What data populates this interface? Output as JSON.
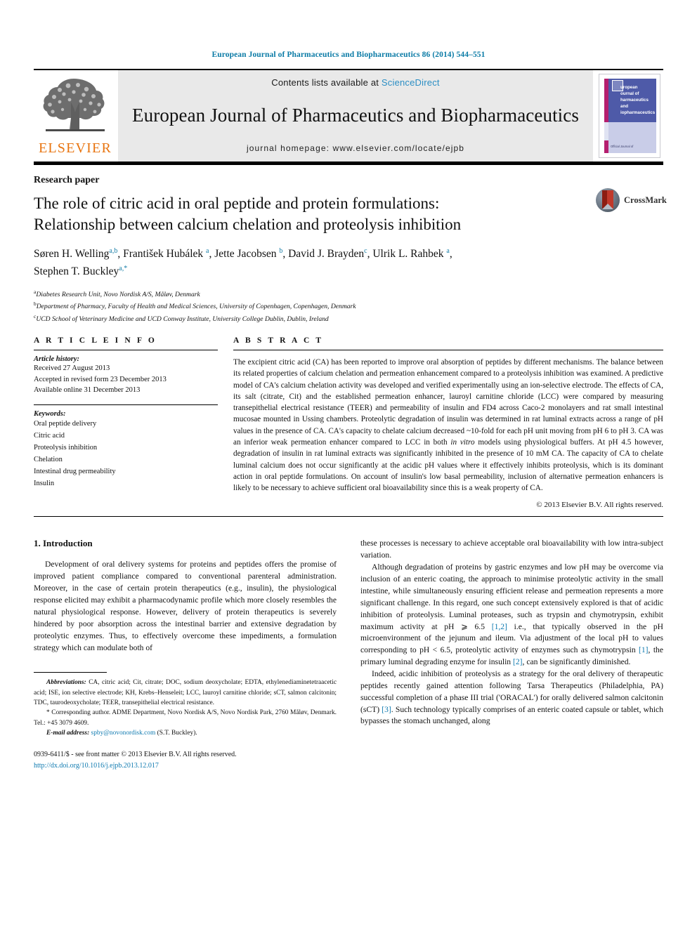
{
  "running_head": "European Journal of Pharmaceutics and Biopharmaceutics 86 (2014) 544–551",
  "masthead": {
    "publisher_name": "ELSEVIER",
    "contents_prefix": "Contents lists available at ",
    "sciencedirect": "ScienceDirect",
    "journal_name": "European Journal of Pharmaceutics and Biopharmaceutics",
    "homepage": "journal homepage: www.elsevier.com/locate/ejpb",
    "cover_title_line1": "uropean",
    "cover_title_line2": "ournal of",
    "cover_title_line3": "harmaceutics and",
    "cover_title_line4": "iopharmaceutics",
    "cover_footer": "Official Journal of"
  },
  "article": {
    "type": "Research paper",
    "title_line1": "The role of citric acid in oral peptide and protein formulations:",
    "title_line2": "Relationship between calcium chelation and proteolysis inhibition",
    "crossmark_label": "CrossMark",
    "authors_line1_parts": [
      {
        "name": "Søren H. Welling",
        "sup": "a,b"
      },
      {
        "name": "František Hubálek",
        "sup": "a"
      },
      {
        "name": "Jette Jacobsen",
        "sup": "b"
      },
      {
        "name": "David J. Brayden",
        "sup": "c"
      },
      {
        "name": "Ulrik L. Rahbek",
        "sup": "a"
      }
    ],
    "authors_line2": [
      {
        "name": "Stephen T. Buckley",
        "sup": "a,*"
      }
    ],
    "affiliations": [
      {
        "marker": "a",
        "text": "Diabetes Research Unit, Novo Nordisk A/S, Måløv, Denmark"
      },
      {
        "marker": "b",
        "text": "Department of Pharmacy, Faculty of Health and Medical Sciences, University of Copenhagen, Copenhagen, Denmark"
      },
      {
        "marker": "c",
        "text": "UCD School of Veterinary Medicine and UCD Conway Institute, University College Dublin, Dublin, Ireland"
      }
    ]
  },
  "article_info": {
    "heading": "A R T I C L E    I N F O",
    "history_label": "Article history:",
    "history": [
      "Received 27 August 2013",
      "Accepted in revised form 23 December 2013",
      "Available online 31 December 2013"
    ],
    "keywords_label": "Keywords:",
    "keywords": [
      "Oral peptide delivery",
      "Citric acid",
      "Proteolysis inhibition",
      "Chelation",
      "Intestinal drug permeability",
      "Insulin"
    ]
  },
  "abstract": {
    "heading": "A B S T R A C T",
    "text": "The excipient citric acid (CA) has been reported to improve oral absorption of peptides by different mechanisms. The balance between its related properties of calcium chelation and permeation enhancement compared to a proteolysis inhibition was examined. A predictive model of CA's calcium chelation activity was developed and verified experimentally using an ion-selective electrode. The effects of CA, its salt (citrate, Cit) and the established permeation enhancer, lauroyl carnitine chloride (LCC) were compared by measuring transepithelial electrical resistance (TEER) and permeability of insulin and FD4 across Caco-2 monolayers and rat small intestinal mucosae mounted in Ussing chambers. Proteolytic degradation of insulin was determined in rat luminal extracts across a range of pH values in the presence of CA. CA's capacity to chelate calcium decreased ~10-fold for each pH unit moving from pH 6 to pH 3. CA was an inferior weak permeation enhancer compared to LCC in both ",
    "text_italic": "in vitro",
    "text_after_italic": " models using physiological buffers. At pH 4.5 however, degradation of insulin in rat luminal extracts was significantly inhibited in the presence of 10 mM CA. The capacity of CA to chelate luminal calcium does not occur significantly at the acidic pH values where it effectively inhibits proteolysis, which is its dominant action in oral peptide formulations. On account of insulin's low basal permeability, inclusion of alternative permeation enhancers is likely to be necessary to achieve sufficient oral bioavailability since this is a weak property of CA.",
    "copyright": "© 2013 Elsevier B.V. All rights reserved."
  },
  "introduction": {
    "heading": "1. Introduction",
    "left_para1": "Development of oral delivery systems for proteins and peptides offers the promise of improved patient compliance compared to conventional parenteral administration. Moreover, in the case of certain protein therapeutics (e.g., insulin), the physiological response elicited may exhibit a pharmacodynamic profile which more closely resembles the natural physiological response. However, delivery of protein therapeutics is severely hindered by poor absorption across the intestinal barrier and extensive degradation by proteolytic enzymes. Thus, to effectively overcome these impediments, a formulation strategy which can modulate both of",
    "right_para1": "these processes is necessary to achieve acceptable oral bioavailability with low intra-subject variation.",
    "right_para2_a": "Although degradation of proteins by gastric enzymes and low pH may be overcome via inclusion of an enteric coating, the approach to minimise proteolytic activity in the small intestine, while simultaneously ensuring efficient release and permeation represents a more significant challenge. In this regard, one such concept extensively explored is that of acidic inhibition of proteolysis. Luminal proteases, such as trypsin and chymotrypsin, exhibit maximum activity at pH ⩾ 6.5 ",
    "right_para2_ref1": "[1,2]",
    "right_para2_b": " i.e., that typically observed in the pH microenvironment of the jejunum and ileum. Via adjustment of the local pH to values corresponding to pH < 6.5, proteolytic activity of enzymes such as chymotrypsin ",
    "right_para2_ref2": "[1]",
    "right_para2_c": ", the primary luminal degrading enzyme for insulin ",
    "right_para2_ref3": "[2]",
    "right_para2_d": ", can be significantly diminished.",
    "right_para3_a": "Indeed, acidic inhibition of proteolysis as a strategy for the oral delivery of therapeutic peptides recently gained attention following Tarsa Therapeutics (Philadelphia, PA) successful completion of a phase III trial ('ORACAL') for orally delivered salmon calcitonin (sCT) ",
    "right_para3_ref": "[3]",
    "right_para3_b": ". Such technology typically comprises of an enteric coated capsule or tablet, which bypasses the stomach unchanged, along"
  },
  "footnotes": {
    "abbrev_label": "Abbreviations:",
    "abbrev_text": " CA, citric acid; Cit, citrate; DOC, sodium deoxycholate; EDTA, ethylenediaminetetraacetic acid; ISE, ion selective electrode; KH, Krebs–Henseleit; LCC, lauroyl carnitine chloride; sCT, salmon calcitonin; TDC, taurodeoxycholate; TEER, transepithelial electrical resistance.",
    "corresponding": "* Corresponding author. ADME Department, Novo Nordisk A/S, Novo Nordisk Park, 2760 Måløv, Denmark. Tel.: +45 3079 4609.",
    "email_label": "E-mail address:",
    "email": "spby@novonordisk.com",
    "email_suffix": " (S.T. Buckley)."
  },
  "footer": {
    "issn_line": "0939-6411/$ - see front matter © 2013 Elsevier B.V. All rights reserved.",
    "doi": "http://dx.doi.org/10.1016/j.ejpb.2013.12.017"
  },
  "colors": {
    "link": "#0f7ab0",
    "running_head": "#0b7ba6",
    "elsevier_orange": "#e87511",
    "sciencedirect": "#2b8ec4"
  }
}
